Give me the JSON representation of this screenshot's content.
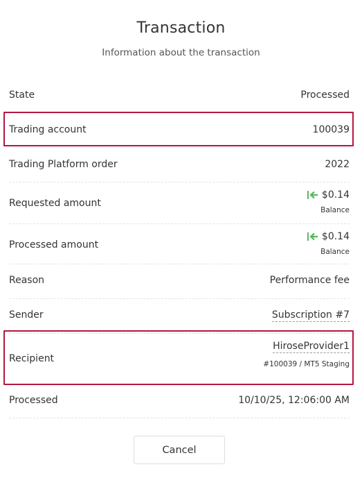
{
  "dialog": {
    "title": "Transaction",
    "subtitle": "Information about the transaction"
  },
  "rows": {
    "state": {
      "label": "State",
      "value": "Processed"
    },
    "trading_account": {
      "label": "Trading account",
      "value": "100039"
    },
    "platform_order": {
      "label": "Trading Platform order",
      "value": "2022"
    },
    "requested_amount": {
      "label": "Requested amount",
      "value": "$0.14",
      "sub": "Balance",
      "icon": "incoming-arrow-icon"
    },
    "processed_amount": {
      "label": "Processed amount",
      "value": "$0.14",
      "sub": "Balance",
      "icon": "incoming-arrow-icon"
    },
    "reason": {
      "label": "Reason",
      "value": "Performance fee"
    },
    "sender": {
      "label": "Sender",
      "value": "Subscription #7"
    },
    "recipient": {
      "label": "Recipient",
      "value": "HiroseProvider1",
      "sub": "#100039 / MT5 Staging"
    },
    "processed": {
      "label": "Processed",
      "value": "10/10/25, 12:06:00 AM"
    }
  },
  "actions": {
    "cancel_label": "Cancel"
  },
  "colors": {
    "highlight": "#b3163f",
    "arrow": "#5cb85c",
    "text": "#333333"
  }
}
